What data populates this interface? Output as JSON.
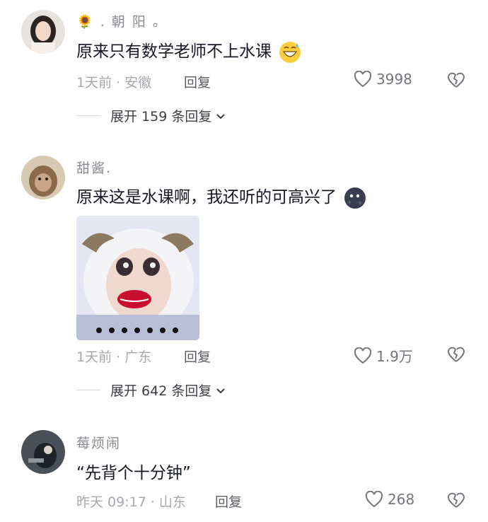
{
  "comments": [
    {
      "username": "🌻 . 朝 阳 。",
      "text": "原来只有数学老师不上水课",
      "emoji": "grinning-sweat-emoji",
      "time_location": "1天前 · 安徽",
      "reply_label": "回复",
      "likes": "3998",
      "expand_label": "展开 159 条回复"
    },
    {
      "username": "甜酱.",
      "text": "原来这是水课啊，我还听的可高兴了",
      "emoji": "dark-moon-face-emoji",
      "sticker": "cartoon-sheep-sticker",
      "time_location": "1天前 · 广东",
      "reply_label": "回复",
      "likes": "1.9万",
      "expand_label": "展开 642 条回复"
    },
    {
      "username": "莓烦闹",
      "text": "“先背个十分钟”",
      "time_location": "昨天 09:17 · 山东",
      "reply_label": "回复",
      "likes": "268"
    }
  ],
  "icons": {
    "like": "heart-outline-icon",
    "dislike": "broken-heart-icon",
    "expand": "chevron-down-icon"
  },
  "colors": {
    "primary_text": "#161823",
    "secondary_text": "#a7a8ad",
    "icon_gray": "#76777d"
  }
}
